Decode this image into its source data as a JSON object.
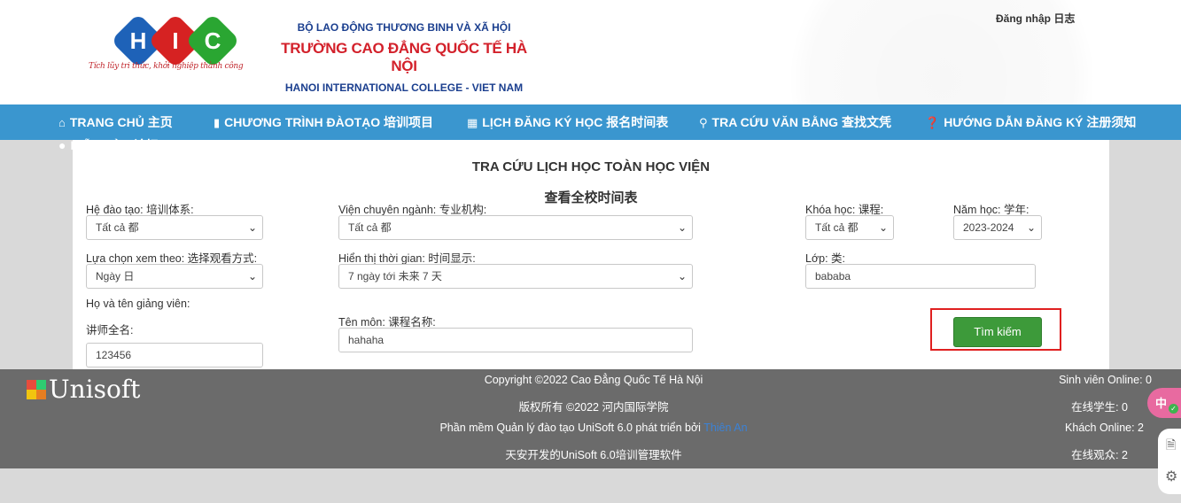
{
  "header": {
    "slogan": "Tích lũy tri thức, khởi nghiệp thành công",
    "ministry": "BỘ LAO ĐỘNG THƯƠNG BINH VÀ XÃ HỘI",
    "college_vi": "TRƯỜNG CAO ĐẲNG QUỐC TẾ HÀ NỘI",
    "college_en": "HANOI INTERNATIONAL COLLEGE - VIET NAM",
    "login": "Đăng nhập 日志"
  },
  "nav": {
    "items": [
      {
        "label": "TRANG CHỦ 主页",
        "icon": "home-icon"
      },
      {
        "label": "CHƯƠNG TRÌNH ĐÀOTẠO 培训项目",
        "icon": "book-icon"
      },
      {
        "label": "LỊCH ĐĂNG KÝ HỌC 报名时间表",
        "icon": "calendar-icon"
      },
      {
        "label": "TRA CỨU VĂN BẰNG 查找文凭",
        "icon": "search-icon"
      },
      {
        "label": "HƯỚNG DẪN ĐĂNG KÝ 注册须知",
        "icon": "question-icon"
      },
      {
        "label": "DIỄN ĐÀN 论坛",
        "icon": "user-icon"
      }
    ]
  },
  "main": {
    "title_vi": "TRA CỨU LỊCH HỌC TOÀN HỌC VIỆN",
    "title_zh": "查看全校时间表",
    "fields": {
      "he_dao_tao": {
        "label": "Hệ đào tạo: 培训体系:",
        "value": "Tất cả 都"
      },
      "vien": {
        "label": "Viện chuyên ngành: 专业机构:",
        "value": "Tất cả 都"
      },
      "khoa_hoc": {
        "label": "Khóa học: 课程:",
        "value": "Tất cả 都"
      },
      "nam_hoc": {
        "label": "Năm học: 学年:",
        "value": "2023-2024"
      },
      "xem_theo": {
        "label": "Lựa chọn xem theo: 选择观看方式:",
        "value": "Ngày 日"
      },
      "thoi_gian": {
        "label": "Hiển thị thời gian: 时间显示:",
        "value": "7 ngày tới 未来 7 天"
      },
      "lop": {
        "label": "Lớp:  类:",
        "value": "bababa"
      },
      "giang_vien": {
        "label_vi": "Họ và tên giảng viên:",
        "label_zh": "讲师全名:",
        "value": "123456"
      },
      "ten_mon": {
        "label": "Tên môn: 课程名称:",
        "value": "hahaha"
      }
    },
    "search_button": "Tìm kiếm"
  },
  "footer": {
    "brand": "Unisoft",
    "copyright": "Copyright ©2022 Cao Đẳng Quốc Tế Hà Nội",
    "copyright_zh": "版权所有 ©2022 河内国际学院",
    "software_prefix": "Phần mềm Quản lý đào tạo UniSoft 6.0 phát triển bởi",
    "software_link": "Thiên An",
    "software_zh": "天安开发的UniSoft 6.0培训管理软件",
    "students_online": "Sinh viên Online: 0",
    "students_online_zh": "在线学生:   0",
    "guests_online": "Khách Online: 2",
    "guests_online_zh": "在线观众:   2"
  },
  "colors": {
    "nav": "#3a96cf",
    "button": "#3d9a3a",
    "highlight": "#e02020",
    "footer": "#6b6b6b"
  }
}
